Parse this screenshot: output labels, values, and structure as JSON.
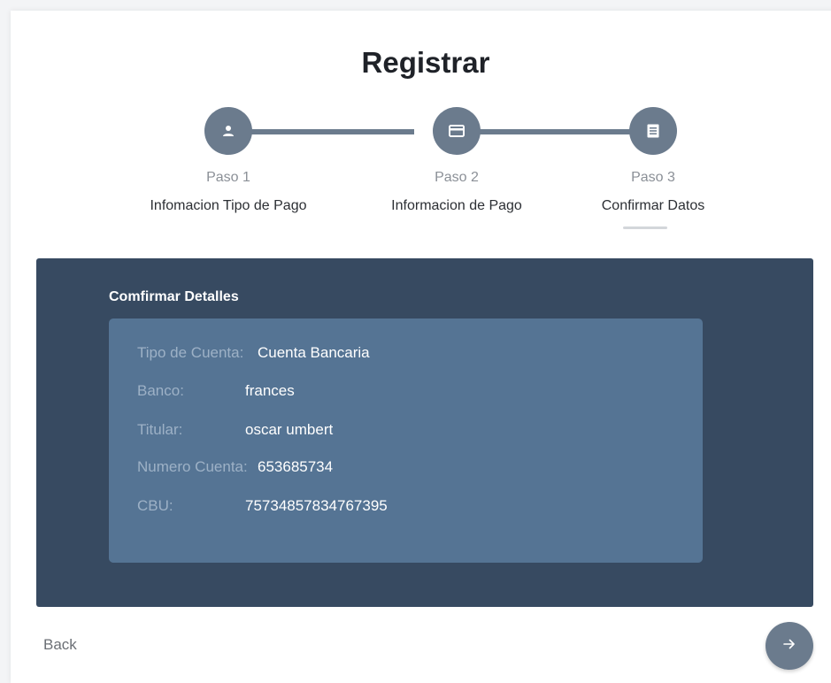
{
  "header": {
    "title": "Registrar"
  },
  "steps": [
    {
      "label": "Paso 1",
      "name": "Infomacion Tipo de Pago",
      "icon": "user-icon"
    },
    {
      "label": "Paso 2",
      "name": "Informacion de Pago",
      "icon": "credit-card-icon"
    },
    {
      "label": "Paso 3",
      "name": "Confirmar Datos",
      "icon": "document-icon",
      "active": true
    }
  ],
  "panel": {
    "title": "Comfirmar Detalles",
    "rows": [
      {
        "key": "Tipo de Cuenta:",
        "value": "Cuenta Bancaria"
      },
      {
        "key": "Banco:",
        "value": "frances"
      },
      {
        "key": "Titular:",
        "value": "oscar umbert"
      },
      {
        "key": "Numero Cuenta:",
        "value": "653685734"
      },
      {
        "key": "CBU:",
        "value": "75734857834767395"
      }
    ]
  },
  "footer": {
    "back_label": "Back",
    "next_icon": "arrow-right-icon"
  },
  "colors": {
    "accent": "#6b7b8d",
    "panel_bg": "#374a61",
    "details_bg": "#557494"
  }
}
